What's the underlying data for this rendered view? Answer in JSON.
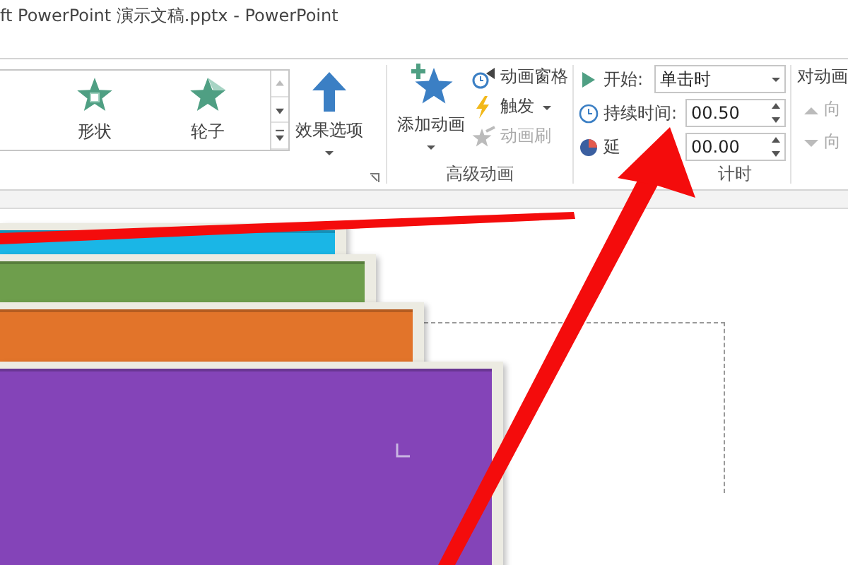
{
  "window": {
    "title": "ft PowerPoint 演示文稿.pptx - PowerPoint"
  },
  "gallery": {
    "items": [
      {
        "label": "形状",
        "kind": "shape"
      },
      {
        "label": "轮子",
        "kind": "wheel"
      }
    ]
  },
  "effect_options": {
    "label": "效果选项"
  },
  "advanced_animation": {
    "label": "高级动画",
    "add_animation": "添加动画",
    "commands": [
      {
        "label": "动画窗格",
        "kind": "pane",
        "disabled": false,
        "dropdown": false
      },
      {
        "label": "触发",
        "kind": "trigger",
        "disabled": false,
        "dropdown": true
      },
      {
        "label": "动画刷",
        "kind": "painter",
        "disabled": true,
        "dropdown": false
      }
    ]
  },
  "timing": {
    "label": "计时",
    "fields": [
      {
        "kind": "dropdown",
        "label": "开始:",
        "value": "单击时"
      },
      {
        "kind": "spinner",
        "label": "持续时间:",
        "value": "00.50"
      },
      {
        "kind": "spinner",
        "label": "延",
        "value": "00.00"
      }
    ]
  },
  "reorder": {
    "label": "对动画",
    "buttons": [
      {
        "label": "向",
        "kind": "up",
        "disabled": true
      },
      {
        "label": "向",
        "kind": "down",
        "disabled": true
      }
    ]
  },
  "slide": {
    "cards": [
      {
        "color": "#1ab6e6"
      },
      {
        "color": "#6e9e4c"
      },
      {
        "color": "#e2742a"
      },
      {
        "color": "#8444b8"
      }
    ]
  }
}
